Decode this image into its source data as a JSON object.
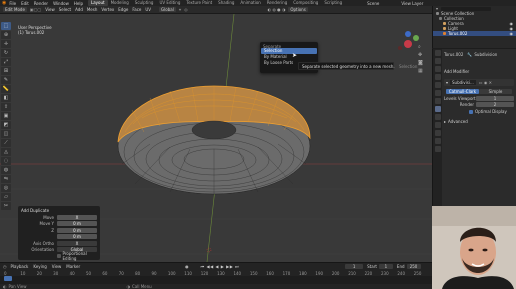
{
  "menu": {
    "items": [
      "File",
      "Edit",
      "Render",
      "Window",
      "Help"
    ],
    "workspaces": [
      "Layout",
      "Modeling",
      "Sculpting",
      "UV Editing",
      "Texture Paint",
      "Shading",
      "Animation",
      "Rendering",
      "Compositing",
      "Scripting"
    ],
    "active_workspace": "Layout",
    "scene": "Scene",
    "view_layer": "View Layer"
  },
  "header": {
    "mode": "Edit Mode",
    "menus": [
      "View",
      "Select",
      "Add",
      "Mesh",
      "Vertex",
      "Edge",
      "Face",
      "UV"
    ],
    "transform": "Global",
    "options": "Options"
  },
  "viewport": {
    "view_name": "User Perspective",
    "object_name": "(1) Torus.002",
    "icons": [
      "view-icon",
      "move-view-icon",
      "camera-icon",
      "grid-icon"
    ]
  },
  "popup": {
    "title": "Separate",
    "items": [
      "Selection",
      "By Material",
      "By Loose Parts"
    ],
    "highlighted": "Selection",
    "tooltip": "Separate selected geometry into a new mesh.",
    "tooltip_hint": "Selection"
  },
  "operator": {
    "title": "Add Duplicate",
    "rows": [
      {
        "label": "Move",
        "value": "X"
      },
      {
        "label": "Move Y",
        "value": "0 m"
      },
      {
        "label": "Z",
        "value": "0 m"
      },
      {
        "label": "",
        "value": "0 m"
      }
    ],
    "axis_label": "Axis Ortho",
    "axis_value": "X",
    "orientation_label": "Orientation",
    "orientation_value": "Global",
    "proportional_label": "Proportional Editing"
  },
  "outliner": {
    "title": "Scene Collection",
    "rows": [
      {
        "name": "Collection",
        "color": "#7a7a7a"
      },
      {
        "name": "Camera",
        "color": "#d0a060"
      },
      {
        "name": "Light",
        "color": "#d0a060"
      },
      {
        "name": "Torus.002",
        "color": "#e08030"
      }
    ],
    "selected": "Torus.002"
  },
  "properties": {
    "object": "Torus.002",
    "modifier_tab": "Subdivision",
    "add_modifier": "Add Modifier",
    "modifier_name": "Subdivisi...",
    "method_a": "Catmull-Clark",
    "method_b": "Simple",
    "levels_viewport_label": "Levels Viewport",
    "levels_viewport": "1",
    "render_label": "Render",
    "render_value": "2",
    "optimal_display": "Optimal Display",
    "advanced": "Advanced"
  },
  "timeline": {
    "menus": [
      "Playback",
      "Keying",
      "View",
      "Marker"
    ],
    "current_frame": "1",
    "start_label": "Start",
    "start": "1",
    "end_label": "End",
    "end": "250",
    "ticks": [
      "0",
      "10",
      "20",
      "30",
      "40",
      "50",
      "60",
      "70",
      "80",
      "90",
      "100",
      "110",
      "120",
      "130",
      "140",
      "150",
      "160",
      "170",
      "180",
      "190",
      "200",
      "210",
      "220",
      "230",
      "240",
      "250"
    ],
    "status_left": "Pan View",
    "status_mid": "Call Menu"
  },
  "colors": {
    "accent": "#4772b3",
    "selection_orange": "#f0a030",
    "viewport_bg": "#393939"
  }
}
